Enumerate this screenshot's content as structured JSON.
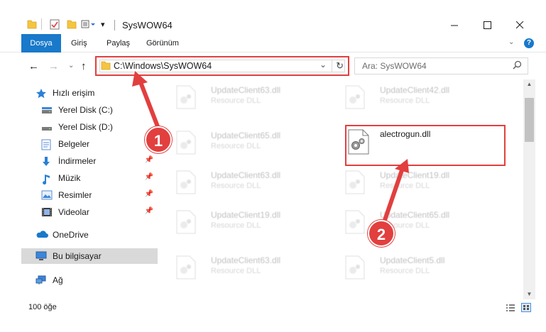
{
  "window": {
    "title": "SysWOW64",
    "controls": [
      "minimize",
      "maximize",
      "close"
    ]
  },
  "ribbon": {
    "tabs": [
      {
        "label": "Dosya",
        "active": true
      },
      {
        "label": "Giriş"
      },
      {
        "label": "Paylaş"
      },
      {
        "label": "Görünüm"
      }
    ]
  },
  "address": {
    "path": "C:\\Windows\\SysWOW64",
    "search_placeholder": "Ara: SysWOW64"
  },
  "sidebar": {
    "items": [
      {
        "label": "Hızlı erişim",
        "icon": "star-icon"
      },
      {
        "label": "Yerel Disk (C:)",
        "icon": "drive-icon"
      },
      {
        "label": "Yerel Disk (D:)",
        "icon": "drive-icon"
      },
      {
        "label": "Belgeler",
        "icon": "documents-icon"
      },
      {
        "label": "İndirmeler",
        "icon": "download-icon",
        "pinned": true
      },
      {
        "label": "Müzik",
        "icon": "music-icon",
        "pinned": true
      },
      {
        "label": "Resimler",
        "icon": "pictures-icon",
        "pinned": true
      },
      {
        "label": "Videolar",
        "icon": "videos-icon",
        "pinned": true
      },
      {
        "label": "OneDrive",
        "icon": "cloud-icon"
      },
      {
        "label": "Bu bilgisayar",
        "icon": "computer-icon",
        "selected": true
      },
      {
        "label": "Ağ",
        "icon": "network-icon"
      }
    ]
  },
  "files": {
    "left_column": [
      {
        "name": "UpdateClient63.dll",
        "type": "Resource DLL"
      },
      {
        "name": "UpdateClient65.dll",
        "type": "Resource DLL"
      },
      {
        "name": "UpdateClient63.dll",
        "type": "Resource DLL"
      },
      {
        "name": "UpdateClient19.dll",
        "type": "Resource DLL"
      },
      {
        "name": "UpdateClient63.dll",
        "type": "Resource DLL"
      }
    ],
    "right_column": [
      {
        "name": "UpdateClient42.dll",
        "type": "Resource DLL"
      },
      {
        "name": "alectrogun.dll",
        "type": "",
        "highlighted": true
      },
      {
        "name": "UpdateClient19.dll",
        "type": "Resource DLL"
      },
      {
        "name": "UpdateClient65.dll",
        "type": "Resource DLL"
      },
      {
        "name": "UpdateClient5.dll",
        "type": "Resource DLL"
      }
    ]
  },
  "status": {
    "count": "100 öğe"
  },
  "annotations": {
    "badge_1": "1",
    "badge_2": "2",
    "color": "#e23f3f"
  }
}
